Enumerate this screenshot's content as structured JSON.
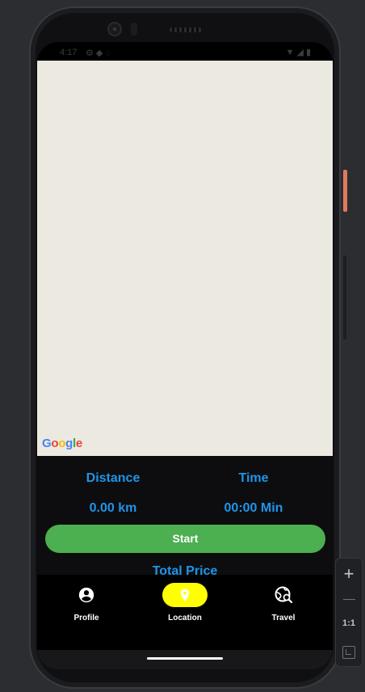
{
  "status_bar": {
    "time": "4:17",
    "icons_left": [
      "settings-icon",
      "shield-icon",
      "wifi-icon"
    ],
    "icons_right": [
      "wifi-icon",
      "signal-icon",
      "battery-icon"
    ]
  },
  "map": {
    "attribution": {
      "G": "G",
      "o1": "o",
      "o2": "o",
      "g": "g",
      "l": "l",
      "e": "e"
    },
    "background_color": "#ece9e1"
  },
  "stats": {
    "distance_label": "Distance",
    "time_label": "Time",
    "distance_value": "0.00 km",
    "time_value": "00:00 Min",
    "start_label": "Start",
    "total_price_label": "Total Price"
  },
  "bottom_nav": {
    "items": [
      {
        "label": "Profile",
        "icon": "account-circle-icon",
        "active": false
      },
      {
        "label": "Location",
        "icon": "location-pin-icon",
        "active": true
      },
      {
        "label": "Travel",
        "icon": "travel-explore-icon",
        "active": false
      }
    ]
  },
  "emulator": {
    "zoom_one_label": "1:1"
  },
  "colors": {
    "accent_blue": "#1f95ea",
    "start_green": "#4caf50",
    "nav_active": "#ffff00"
  }
}
